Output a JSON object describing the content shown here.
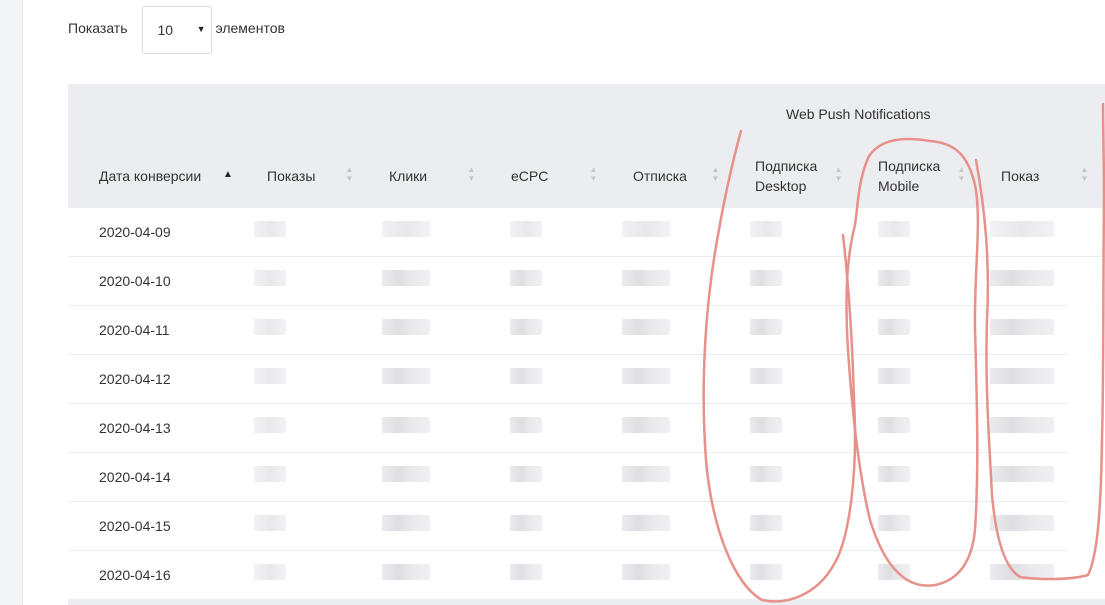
{
  "length_control": {
    "show_label": "Показать",
    "per_page_value": "10",
    "after_label": "элементов"
  },
  "table": {
    "group_header": "Web Push Notifications",
    "columns": [
      {
        "label": "Дата конверсии",
        "sort": "asc"
      },
      {
        "label": "Показы",
        "sort": "none"
      },
      {
        "label": "Клики",
        "sort": "none"
      },
      {
        "label": "eCPC",
        "sort": "none"
      },
      {
        "label": "Отписка",
        "sort": "none"
      },
      {
        "label_line1": "Подписка",
        "label_line2": "Desktop",
        "sort": "none"
      },
      {
        "label_line1": "Подписка",
        "label_line2": "Mobile",
        "sort": "none"
      },
      {
        "label": "Показ",
        "sort": "none"
      }
    ],
    "rows": [
      {
        "date": "2020-04-09"
      },
      {
        "date": "2020-04-10"
      },
      {
        "date": "2020-04-11"
      },
      {
        "date": "2020-04-12"
      },
      {
        "date": "2020-04-13"
      },
      {
        "date": "2020-04-14"
      },
      {
        "date": "2020-04-15"
      },
      {
        "date": "2020-04-16"
      }
    ]
  },
  "colors": {
    "header_bg": "#ecedf1",
    "annotation_red": "#e8908a"
  }
}
